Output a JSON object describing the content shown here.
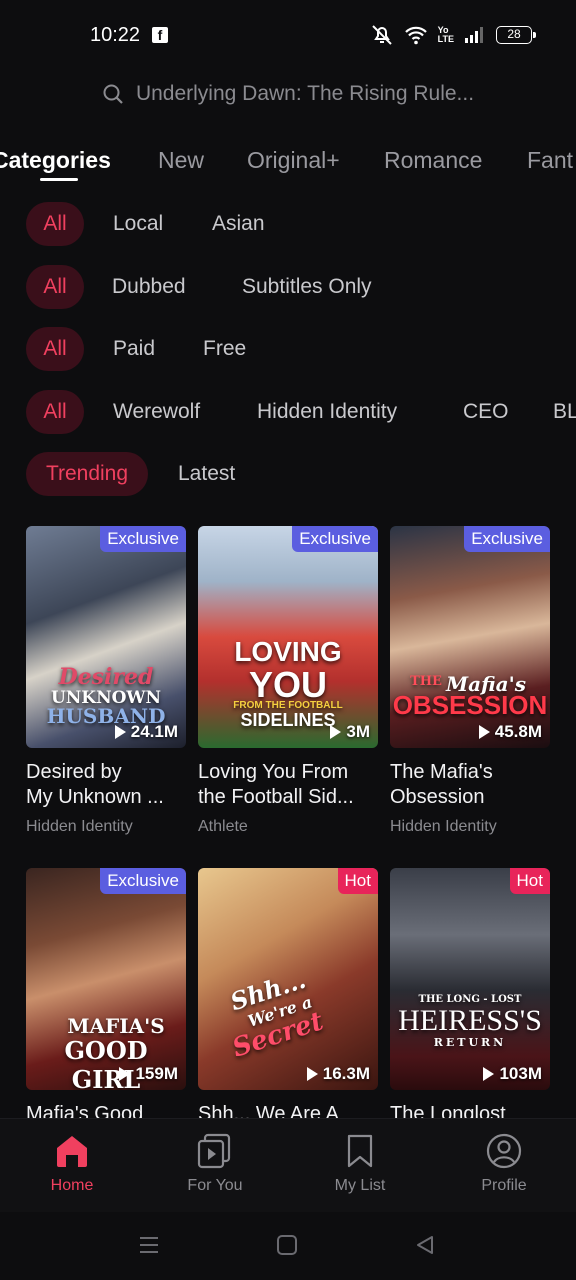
{
  "status_bar": {
    "time": "10:22",
    "battery": "28"
  },
  "search": {
    "placeholder": "Underlying Dawn: The Rising Rule..."
  },
  "category_tabs": [
    "Categories",
    "New",
    "Original+",
    "Romance",
    "Fant"
  ],
  "filters": {
    "region": [
      "All",
      "Local",
      "Asian"
    ],
    "audio": [
      "All",
      "Dubbed",
      "Subtitles Only"
    ],
    "price": [
      "All",
      "Paid",
      "Free"
    ],
    "genre": [
      "All",
      "Werewolf",
      "Hidden Identity",
      "CEO",
      "BL"
    ],
    "sort": [
      "Trending",
      "Latest"
    ]
  },
  "cards": [
    {
      "title1": "Desired by",
      "title2": "My Unknown ...",
      "genre": "Hidden Identity",
      "views": "24.1M",
      "badge": "Exclusive",
      "cover_text": "Desired UNKNOWN HUSBAND",
      "cover_a": "Desired",
      "cover_b": "UNKNOWN",
      "cover_c": "HUSBAND",
      "by": "By My"
    },
    {
      "title1": "Loving You From",
      "title2": "the Football Sid...",
      "genre": "Athlete",
      "views": "3M",
      "badge": "Exclusive",
      "cover_a": "LOVING",
      "cover_b": "YOU",
      "cover_c": "FROM THE FOOTBALL",
      "cover_d": "SIDELINES"
    },
    {
      "title1": "The Mafia's",
      "title2": "Obsession",
      "genre": "Hidden Identity",
      "views": "45.8M",
      "badge": "Exclusive",
      "cover_a": "THE",
      "cover_b": "Mafia's",
      "cover_c": "OBSESSION"
    },
    {
      "title1": "Mafia's Good",
      "genre": "",
      "views": "159M",
      "badge": "Exclusive",
      "cover_a": "MAFIA'S",
      "cover_b": "GOOD GIRL"
    },
    {
      "title1": "Shh... We Are A",
      "genre": "",
      "views": "16.3M",
      "badge": "Hot",
      "cover_a": "Shh...",
      "cover_b": "We're a",
      "cover_c": "Secret"
    },
    {
      "title1": "The Longlost",
      "genre": "",
      "views": "103M",
      "badge": "Hot",
      "cover_a": "THE LONG - LOST",
      "cover_b": "HEIRESS'S",
      "cover_c": "RETURN"
    }
  ],
  "bottom_nav": [
    "Home",
    "For You",
    "My List",
    "Profile"
  ],
  "colors": {
    "accent": "#f0405f",
    "exclusive_badge": "#5b5ee0",
    "hot_badge": "#e8245a",
    "background": "#0d0d0f"
  }
}
